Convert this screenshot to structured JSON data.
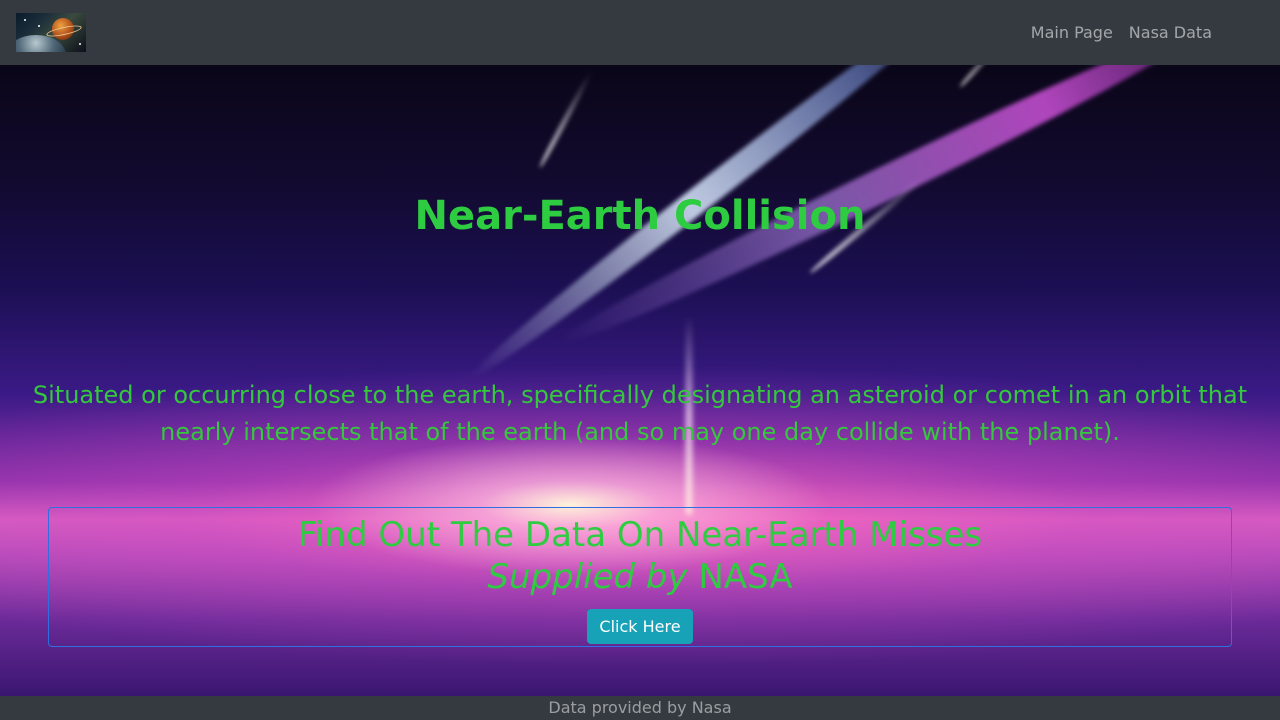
{
  "nav": {
    "logo_icon": "space-planet-logo",
    "links": [
      {
        "label": "Main Page"
      },
      {
        "label": "Nasa Data"
      }
    ]
  },
  "hero": {
    "title": "Near-Earth Collision",
    "description": "Situated or occurring close to the earth, specifically designating an asteroid or comet in an orbit that nearly intersects that of the earth (and so may one day collide with the planet).",
    "cta": {
      "heading": "Find Out The Data On Near-Earth Misses",
      "sub_italic": "Supplied by",
      "sub_rest": "NASA",
      "button_label": "Click Here"
    }
  },
  "footer": {
    "text": "Data provided by Nasa"
  },
  "colors": {
    "navbar": "#343a40",
    "heading_green": "#2ecc40",
    "button": "#17a2b8",
    "cta_border": "#2f6fe0"
  }
}
